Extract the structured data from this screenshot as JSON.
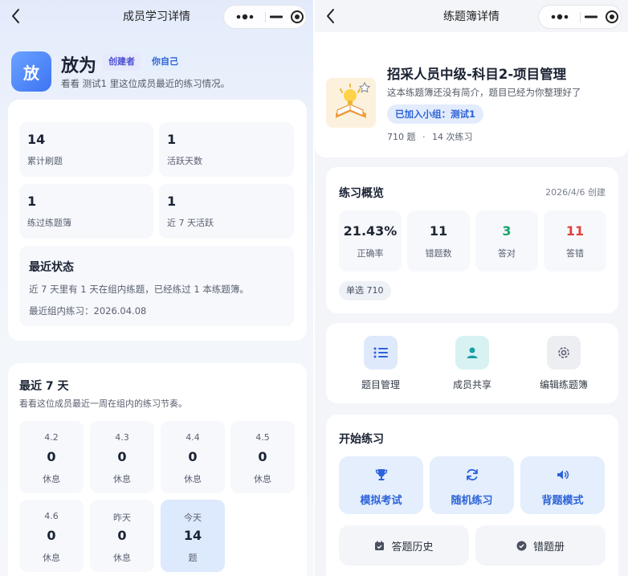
{
  "left": {
    "nav_title": "成员学习详情",
    "member": {
      "avatar_text": "放",
      "name": "放为",
      "tags": [
        "创建者",
        "你自己"
      ],
      "description": "看看 测试1 里这位成员最近的练习情况。"
    },
    "stats": [
      {
        "value": "14",
        "label": "累计刷题"
      },
      {
        "value": "1",
        "label": "活跃天数"
      },
      {
        "value": "1",
        "label": "练过练题簿"
      },
      {
        "value": "1",
        "label": "近 7 天活跃"
      }
    ],
    "recent_status": {
      "title": "最近状态",
      "summary": "近 7 天里有 1 天在组内练题，已经练过 1 本练题簿。",
      "last_practice": "最近组内练习：2026.04.08"
    },
    "last7": {
      "title": "最近 7 天",
      "subtitle": "看看这位成员最近一周在组内的练习节奏。",
      "days": [
        {
          "date": "4.2",
          "count": "0",
          "status": "休息"
        },
        {
          "date": "4.3",
          "count": "0",
          "status": "休息"
        },
        {
          "date": "4.4",
          "count": "0",
          "status": "休息"
        },
        {
          "date": "4.5",
          "count": "0",
          "status": "休息"
        },
        {
          "date": "4.6",
          "count": "0",
          "status": "休息"
        },
        {
          "date": "昨天",
          "count": "0",
          "status": "休息"
        },
        {
          "date": "今天",
          "count": "14",
          "status": "题"
        }
      ]
    }
  },
  "right": {
    "nav_title": "练题簿详情",
    "book": {
      "title": "招采人员中级-科目2-项目管理",
      "description": "这本练题簿还没有简介，题目已经为你整理好了",
      "group_badge": "已加入小组：测试1",
      "questions": "710 题",
      "separator": "·",
      "practices": "14 次练习"
    },
    "overview": {
      "title": "练习概览",
      "created": "2026/4/6 创建",
      "metrics": [
        {
          "value": "21.43%",
          "label": "正确率",
          "color": "#1a2233"
        },
        {
          "value": "11",
          "label": "错题数",
          "color": "#1a2233"
        },
        {
          "value": "3",
          "label": "答对",
          "color": "#1ca36a"
        },
        {
          "value": "11",
          "label": "答错",
          "color": "#e0413d"
        }
      ],
      "type_chip": "单选 710"
    },
    "actions": [
      {
        "label": "题目管理",
        "icon": "list-icon"
      },
      {
        "label": "成员共享",
        "icon": "user-icon"
      },
      {
        "label": "编辑练题簿",
        "icon": "gear-icon"
      }
    ],
    "start": {
      "title": "开始练习",
      "modes": [
        {
          "label": "模拟考试",
          "icon": "trophy-icon"
        },
        {
          "label": "随机练习",
          "icon": "refresh-icon"
        },
        {
          "label": "背题模式",
          "icon": "speaker-icon"
        }
      ],
      "history_label": "答题历史",
      "wrongbook_label": "错题册"
    }
  },
  "colors": {
    "accent": "#3d74f5",
    "success": "#1ca36a",
    "danger": "#e0413d",
    "tag_bg": "#e6e9fb",
    "tag_text": "#4b4fd1"
  }
}
